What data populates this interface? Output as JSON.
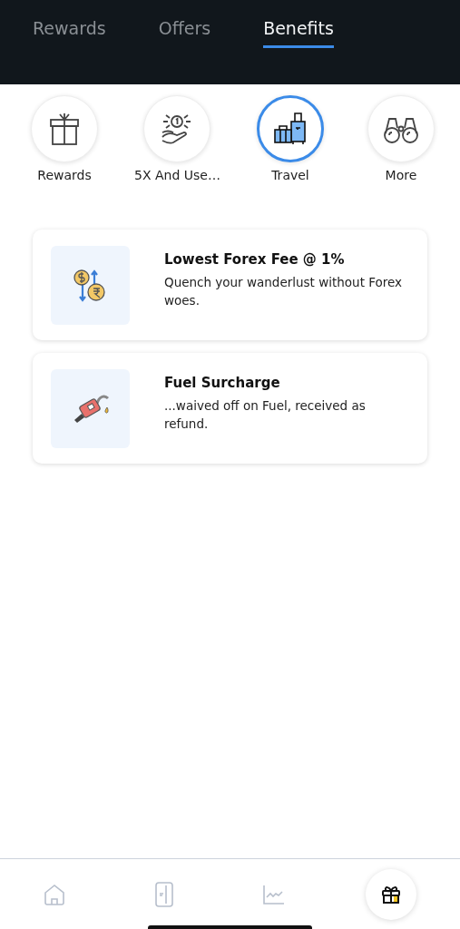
{
  "tabs": [
    {
      "label": "Rewards",
      "selected": false
    },
    {
      "label": "Offers",
      "selected": false
    },
    {
      "label": "Benefits",
      "selected": true
    }
  ],
  "categories": [
    {
      "kind": "gift",
      "label": "Rewards",
      "selected": false
    },
    {
      "kind": "coin-hand",
      "label": "5X And Use…",
      "selected": false
    },
    {
      "kind": "luggage",
      "label": "Travel",
      "selected": true
    },
    {
      "kind": "binoculars",
      "label": "More",
      "selected": false
    }
  ],
  "benefits": [
    {
      "kind": "forex",
      "title": "Lowest Forex Fee @ 1%",
      "description": "Quench your wanderlust without Forex woes."
    },
    {
      "kind": "fuel",
      "title": "Fuel Surcharge",
      "description": "...waived off on Fuel, received as refund."
    }
  ],
  "bottom_nav": [
    {
      "kind": "home",
      "selected": false
    },
    {
      "kind": "card",
      "selected": false
    },
    {
      "kind": "chart",
      "selected": false
    },
    {
      "kind": "gift",
      "selected": true
    }
  ]
}
